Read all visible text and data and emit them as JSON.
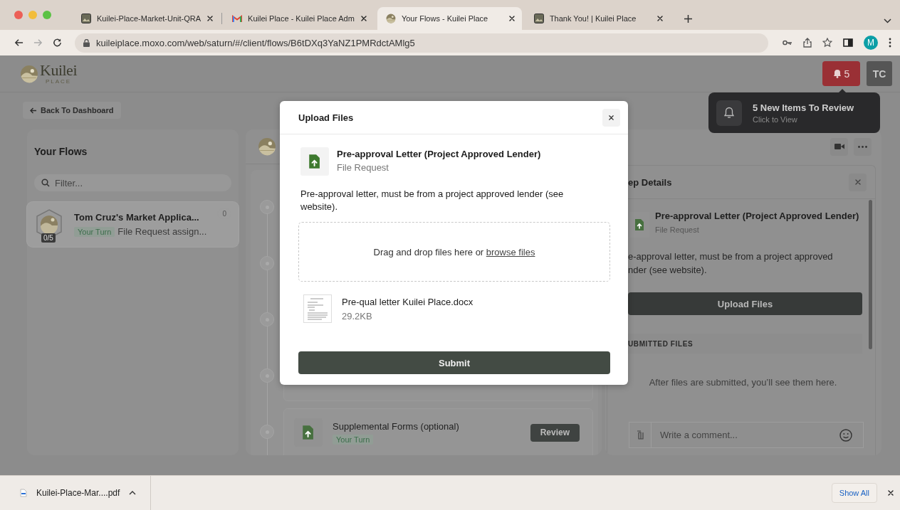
{
  "browser": {
    "tabs": [
      {
        "title": "Kuilei-Place-Market-Unit-QRA",
        "kind": "photo",
        "selected": false
      },
      {
        "title": "Kuilei Place - Kuilei Place Adm",
        "kind": "mail",
        "selected": false
      },
      {
        "title": "Your Flows - Kuilei Place",
        "kind": "logo",
        "selected": true
      },
      {
        "title": "Thank You! | Kuilei Place",
        "kind": "photo",
        "selected": false
      }
    ],
    "address": "kuileiplace.moxo.com/web/saturn/#/client/flows/B6tDXq3YaNZ1PMRdctAMlg5",
    "profile_initial": "M"
  },
  "app": {
    "logo": "Kuilei",
    "logo_tagline": "PLACE",
    "notification_count": "5",
    "user_initials": "TC",
    "back": "Back To Dashboard"
  },
  "toast": {
    "title": "5 New Items To Review",
    "subtitle": "Click to View"
  },
  "sidebar": {
    "title": "Your Flows",
    "filter_placeholder": "Filter...",
    "flows": [
      {
        "title": "Tom Cruz's Market Applica...",
        "progress": "0/5",
        "count": "0",
        "badge": "Your Turn",
        "summary": "File Request assign...",
        "selected": true
      }
    ]
  },
  "steps": [
    {
      "title": "Supplemental Forms (optional)",
      "badge": "Your Turn",
      "action": "Review"
    }
  ],
  "step_details": {
    "title": "ep Details",
    "item_title": "Pre-approval Letter (Project Approved Lender)",
    "item_type": "File Request",
    "description": "e-approval letter, must be from a project approved nder (see website).",
    "upload": "Upload Files",
    "submitted_heading": "UBMITTED FILES",
    "empty_note": "After files are submitted, you’ll see them here.",
    "comment_placeholder": "Write a comment..."
  },
  "modal": {
    "title": "Upload Files",
    "item_title": "Pre-approval Letter (Project Approved Lender)",
    "item_type": "File Request",
    "description": "Pre-approval letter, must be from a project approved lender (see website).",
    "drop_text": "Drag and drop files here or",
    "browse_link": "browse files",
    "files": [
      {
        "name": "Pre-qual letter Kuilei Place.docx",
        "size": "29.2KB"
      }
    ],
    "submit": "Submit"
  },
  "downloads": {
    "items": [
      {
        "name": "Kuilei-Place-Mar....pdf"
      }
    ],
    "show_all": "Show All"
  }
}
